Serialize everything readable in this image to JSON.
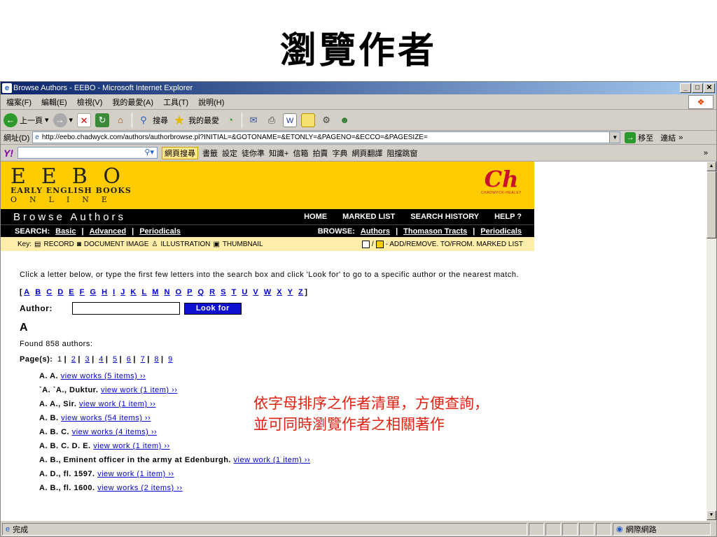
{
  "slide": {
    "title": "瀏覽作者"
  },
  "window": {
    "title": "Browse Authors - EEBO - Microsoft Internet Explorer",
    "btn_min": "_",
    "btn_max": "□",
    "btn_close": "✕"
  },
  "menu": [
    "檔案(F)",
    "編輯(E)",
    "檢視(V)",
    "我的最愛(A)",
    "工具(T)",
    "說明(H)"
  ],
  "toolbar": {
    "back": "上一頁",
    "search": "搜尋",
    "favorites": "我的最愛"
  },
  "address": {
    "label": "網址(D)",
    "url": "http://eebo.chadwyck.com/authors/authorbrowse.pl?INITIAL=&GOTONAME=&ETONLY=&PAGENO=&ECCO=&PAGESIZE=",
    "go": "移至",
    "links": "連結"
  },
  "yahoo": {
    "logo": "Y!",
    "search_btn": "網頁搜尋",
    "items": [
      "書籤",
      "設定",
      "徒你準",
      "知識+",
      "信箱",
      "拍賣",
      "字典",
      "網頁翻譯",
      "阻擋跳窗"
    ]
  },
  "eebo": {
    "letters": "EEBO",
    "sub": "EARLY ENGLISH BOOKS",
    "online": "ONLINE",
    "ch_mark": "Ch",
    "ch_text": "CHADWYCK-HEALEY",
    "browse_title": "Browse Authors",
    "nav": [
      "HOME",
      "MARKED LIST",
      "SEARCH HISTORY",
      "HELP ?"
    ],
    "search_label": "SEARCH:",
    "search_links": [
      "Basic",
      "Advanced",
      "Periodicals"
    ],
    "browse_label": "BROWSE:",
    "browse_links": [
      "Authors",
      "Thomason Tracts",
      "Periodicals"
    ],
    "key_label": "Key:",
    "key_items": [
      "RECORD",
      "DOCUMENT IMAGE",
      "ILLUSTRATION",
      "THUMBNAIL"
    ],
    "key_right": "- ADD/REMOVE. TO/FROM. MARKED LIST"
  },
  "content": {
    "instructions": "Click a letter below, or type the first few letters into the search box and click 'Look for' to go to a specific author or the nearest match.",
    "alphabet": [
      "A",
      "B",
      "C",
      "D",
      "E",
      "F",
      "G",
      "H",
      "I",
      "J",
      "K",
      "L",
      "M",
      "N",
      "O",
      "P",
      "Q",
      "R",
      "S",
      "T",
      "U",
      "V",
      "W",
      "X",
      "Y",
      "Z"
    ],
    "author_label": "Author:",
    "look_for": "Look for",
    "heading_letter": "A",
    "found": "Found 858 authors:",
    "pages_label": "Page(s):",
    "current_page": "1",
    "pages": [
      "2",
      "3",
      "4",
      "5",
      "6",
      "7",
      "8",
      "9"
    ],
    "authors": [
      {
        "name": "A. A.",
        "link": "view works (5 items) ››"
      },
      {
        "name": "`A. `A., Duktur.",
        "link": "view work (1 item) ››"
      },
      {
        "name": "A. A., Sir.",
        "link": "view work (1 item) ››"
      },
      {
        "name": "A. B.",
        "link": "view works (54 items) ››"
      },
      {
        "name": "A. B. C.",
        "link": "view works (4 items) ››"
      },
      {
        "name": "A. B. C. D. E.",
        "link": "view work (1 item) ››"
      },
      {
        "name": "A. B., Eminent officer in the army at Edenburgh.",
        "link": "view work (1 item) ››"
      },
      {
        "name": "A. D., fl. 1597.",
        "link": "view work (1 item) ››"
      },
      {
        "name": "A. B., fl. 1600.",
        "link": "view works (2 items) ››"
      }
    ]
  },
  "annotation": "依字母排序之作者清單，方便查詢，並可同時瀏覽作者之相關著作",
  "status": {
    "text": "完成",
    "zone": "網際網路"
  }
}
